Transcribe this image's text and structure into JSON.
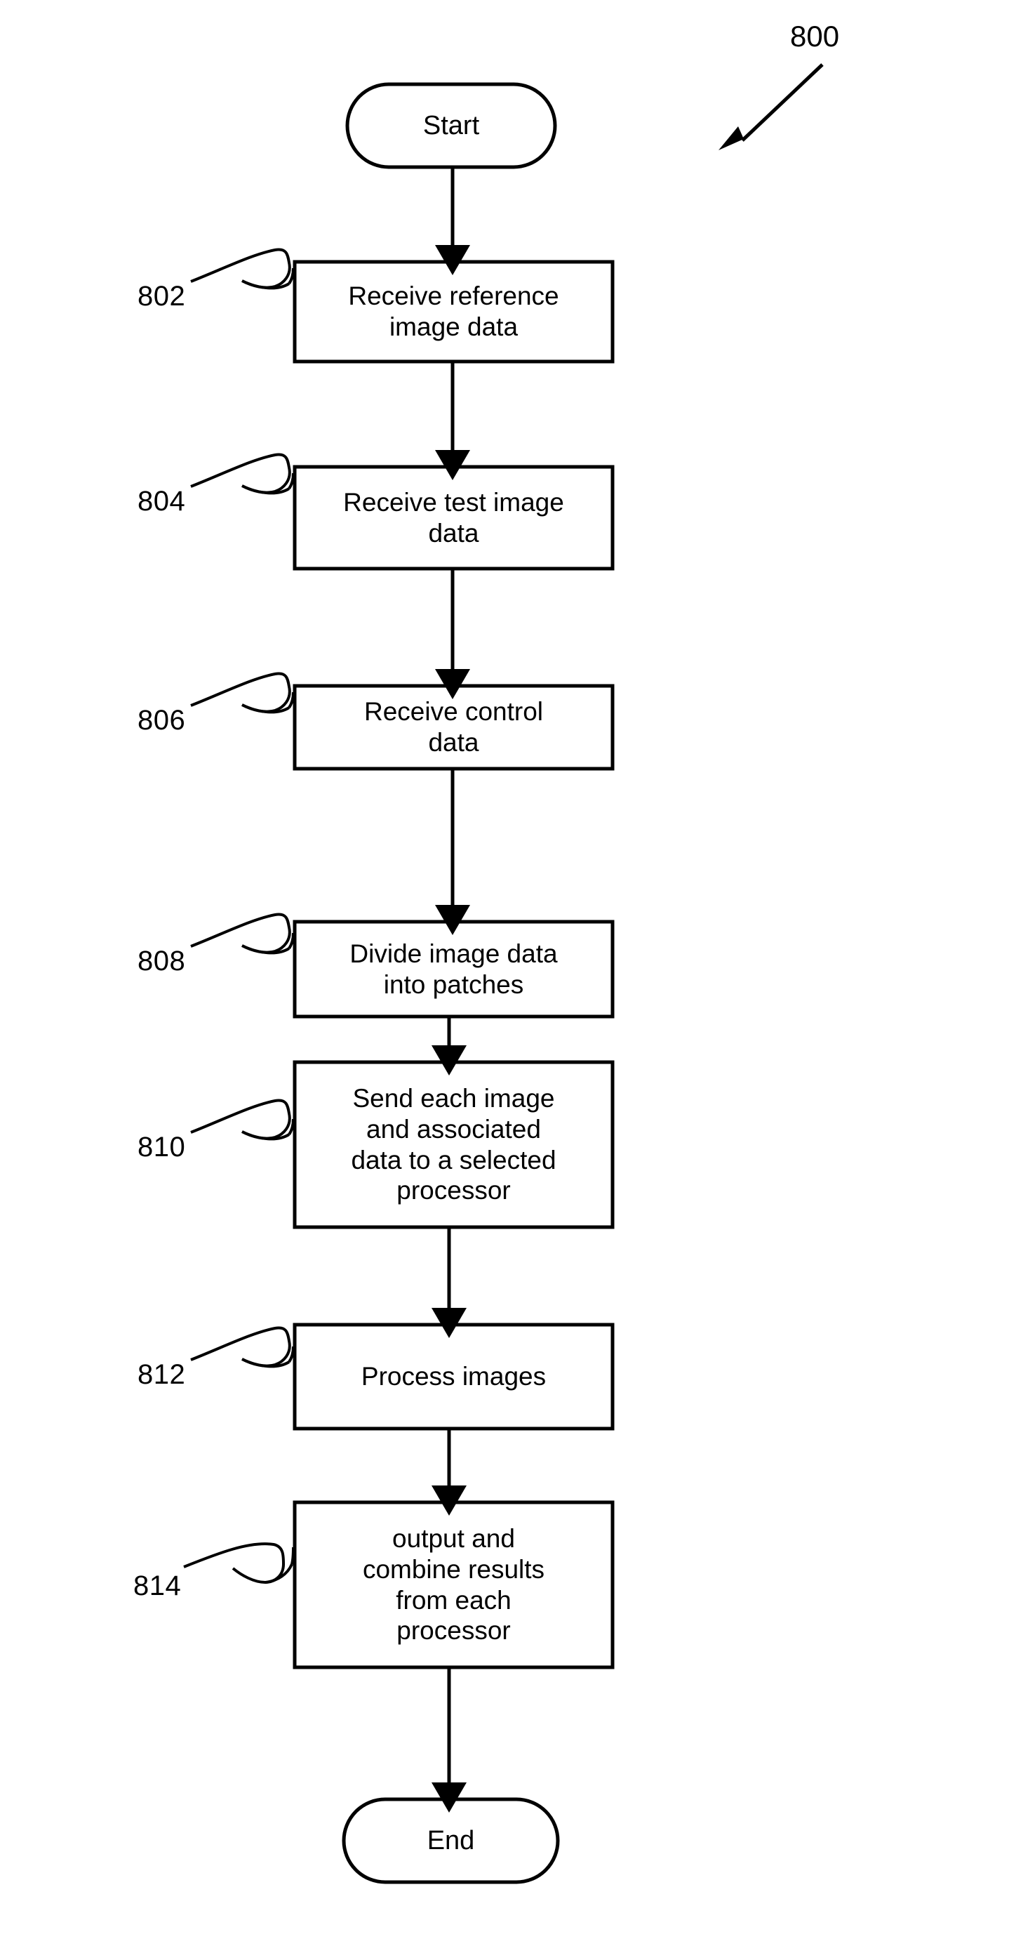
{
  "figure": {
    "number": "800",
    "title_arrow": "diagonal-pointer-arrow"
  },
  "diagram": {
    "type": "flowchart",
    "orientation": "vertical",
    "stroke_color": "#000000",
    "fill_color": "#ffffff",
    "background_color": "#ffffff",
    "nodes": [
      {
        "id": "start",
        "shape": "stadium",
        "label": "Start",
        "ref": null
      },
      {
        "id": "step-802",
        "shape": "rectangle",
        "label": "Receive reference\nimage data",
        "ref": "802"
      },
      {
        "id": "step-804",
        "shape": "rectangle",
        "label": "Receive test image\ndata",
        "ref": "804"
      },
      {
        "id": "step-806",
        "shape": "rectangle",
        "label": "Receive control\ndata",
        "ref": "806"
      },
      {
        "id": "step-808",
        "shape": "rectangle",
        "label": "Divide image data\ninto patches",
        "ref": "808"
      },
      {
        "id": "step-810",
        "shape": "rectangle",
        "label": "Send each image\nand associated\ndata to a selected\nprocessor",
        "ref": "810"
      },
      {
        "id": "step-812",
        "shape": "rectangle",
        "label": "Process images",
        "ref": "812"
      },
      {
        "id": "step-814",
        "shape": "rectangle",
        "label": "output and\ncombine results\nfrom each\nprocessor",
        "ref": "814"
      },
      {
        "id": "end",
        "shape": "stadium",
        "label": "End",
        "ref": null
      }
    ],
    "edges": [
      {
        "from": "start",
        "to": "step-802",
        "arrow": "down"
      },
      {
        "from": "step-802",
        "to": "step-804",
        "arrow": "down"
      },
      {
        "from": "step-804",
        "to": "step-806",
        "arrow": "down"
      },
      {
        "from": "step-806",
        "to": "step-808",
        "arrow": "down"
      },
      {
        "from": "step-808",
        "to": "step-810",
        "arrow": "down"
      },
      {
        "from": "step-810",
        "to": "step-812",
        "arrow": "down"
      },
      {
        "from": "step-812",
        "to": "step-814",
        "arrow": "down"
      },
      {
        "from": "step-814",
        "to": "end",
        "arrow": "down"
      }
    ]
  }
}
